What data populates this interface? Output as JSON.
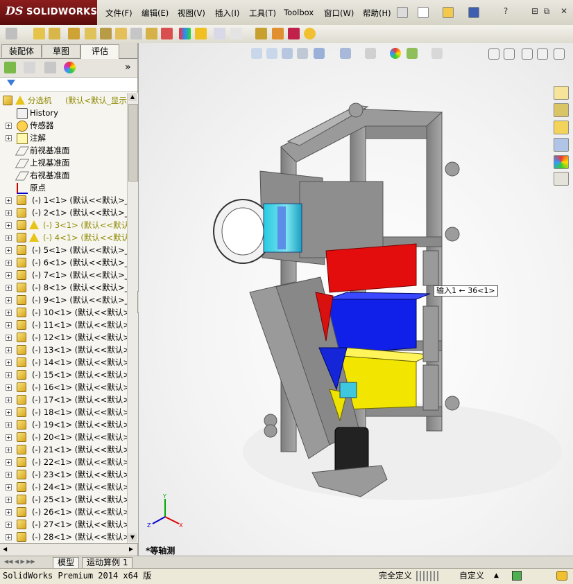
{
  "app": {
    "brand_ds": "DS",
    "brand_name": "SOLIDWORKS"
  },
  "menu": [
    {
      "label": "文件(F)"
    },
    {
      "label": "编辑(E)"
    },
    {
      "label": "视图(V)"
    },
    {
      "label": "插入(I)"
    },
    {
      "label": "工具(T)"
    },
    {
      "label": "Toolbox"
    },
    {
      "label": "窗口(W)"
    },
    {
      "label": "帮助(H)"
    }
  ],
  "panel": {
    "tabs": [
      {
        "label": "装配体",
        "active": false
      },
      {
        "label": "草图",
        "active": false
      },
      {
        "label": "评估",
        "active": true
      }
    ],
    "expand_glyph": "»"
  },
  "tree": {
    "root": {
      "label": "分选机",
      "config": "(默认<默认_显示"
    },
    "fixed_items": [
      {
        "label": "History",
        "icon": "history-icon"
      },
      {
        "label": "传感器",
        "icon": "sensor-icon"
      },
      {
        "label": "注解",
        "icon": "annotation-icon"
      },
      {
        "label": "前视基准面",
        "icon": "plane-icon"
      },
      {
        "label": "上视基准面",
        "icon": "plane-icon"
      },
      {
        "label": "右视基准面",
        "icon": "plane-icon"
      },
      {
        "label": "原点",
        "icon": "origin-icon"
      }
    ],
    "components": [
      {
        "label": "(-) 1<1> (默认<<默认>_显",
        "warning": false
      },
      {
        "label": "(-) 2<1> (默认<<默认>_显",
        "warning": false
      },
      {
        "label": "(-) 3<1> (默认<<默认",
        "warning": true
      },
      {
        "label": "(-) 4<1> (默认<<默认",
        "warning": true
      },
      {
        "label": "(-) 5<1> (默认<<默认>_显",
        "warning": false
      },
      {
        "label": "(-) 6<1> (默认<<默认>_显",
        "warning": false
      },
      {
        "label": "(-) 7<1> (默认<<默认>_显",
        "warning": false
      },
      {
        "label": "(-) 8<1> (默认<<默认>_显",
        "warning": false
      },
      {
        "label": "(-) 9<1> (默认<<默认>_显",
        "warning": false
      },
      {
        "label": "(-) 10<1> (默认<<默认>_",
        "warning": false
      },
      {
        "label": "(-) 11<1> (默认<<默认>_",
        "warning": false
      },
      {
        "label": "(-) 12<1> (默认<<默认>_",
        "warning": false
      },
      {
        "label": "(-) 13<1> (默认<<默认>_",
        "warning": false
      },
      {
        "label": "(-) 14<1> (默认<<默认>_",
        "warning": false
      },
      {
        "label": "(-) 15<1> (默认<<默认>_",
        "warning": false
      },
      {
        "label": "(-) 16<1> (默认<<默认>_",
        "warning": false
      },
      {
        "label": "(-) 17<1> (默认<<默认>_",
        "warning": false
      },
      {
        "label": "(-) 18<1> (默认<<默认>_",
        "warning": false
      },
      {
        "label": "(-) 19<1> (默认<<默认>_",
        "warning": false
      },
      {
        "label": "(-) 20<1> (默认<<默认>_",
        "warning": false
      },
      {
        "label": "(-) 21<1> (默认<<默认>_",
        "warning": false
      },
      {
        "label": "(-) 22<1> (默认<<默认>_",
        "warning": false
      },
      {
        "label": "(-) 23<1> (默认<<默认>_",
        "warning": false
      },
      {
        "label": "(-) 24<1> (默认<<默认>_",
        "warning": false
      },
      {
        "label": "(-) 25<1> (默认<<默认>_",
        "warning": false
      },
      {
        "label": "(-) 26<1> (默认<<默认>_",
        "warning": false
      },
      {
        "label": "(-) 27<1> (默认<<默认>_",
        "warning": false
      },
      {
        "label": "(-) 28<1> (默认<<默认>_",
        "warning": false
      }
    ]
  },
  "viewport": {
    "callout": "输入1 ← 36<1>",
    "view_name": "*等轴测",
    "triad": {
      "x": "X",
      "y": "Y",
      "z": "Z"
    }
  },
  "model_tabs": [
    {
      "label": "模型",
      "active": true
    },
    {
      "label": "运动算例 1",
      "active": false
    }
  ],
  "status": {
    "product": "SolidWorks Premium 2014 x64 版",
    "state": "完全定义",
    "units": "自定义"
  },
  "colors": {
    "accent_red": "#8c1d1d",
    "frame_gray": "#8e8e8e",
    "warning_yellow": "#e8c41a",
    "olive_text": "#8f8a00"
  }
}
